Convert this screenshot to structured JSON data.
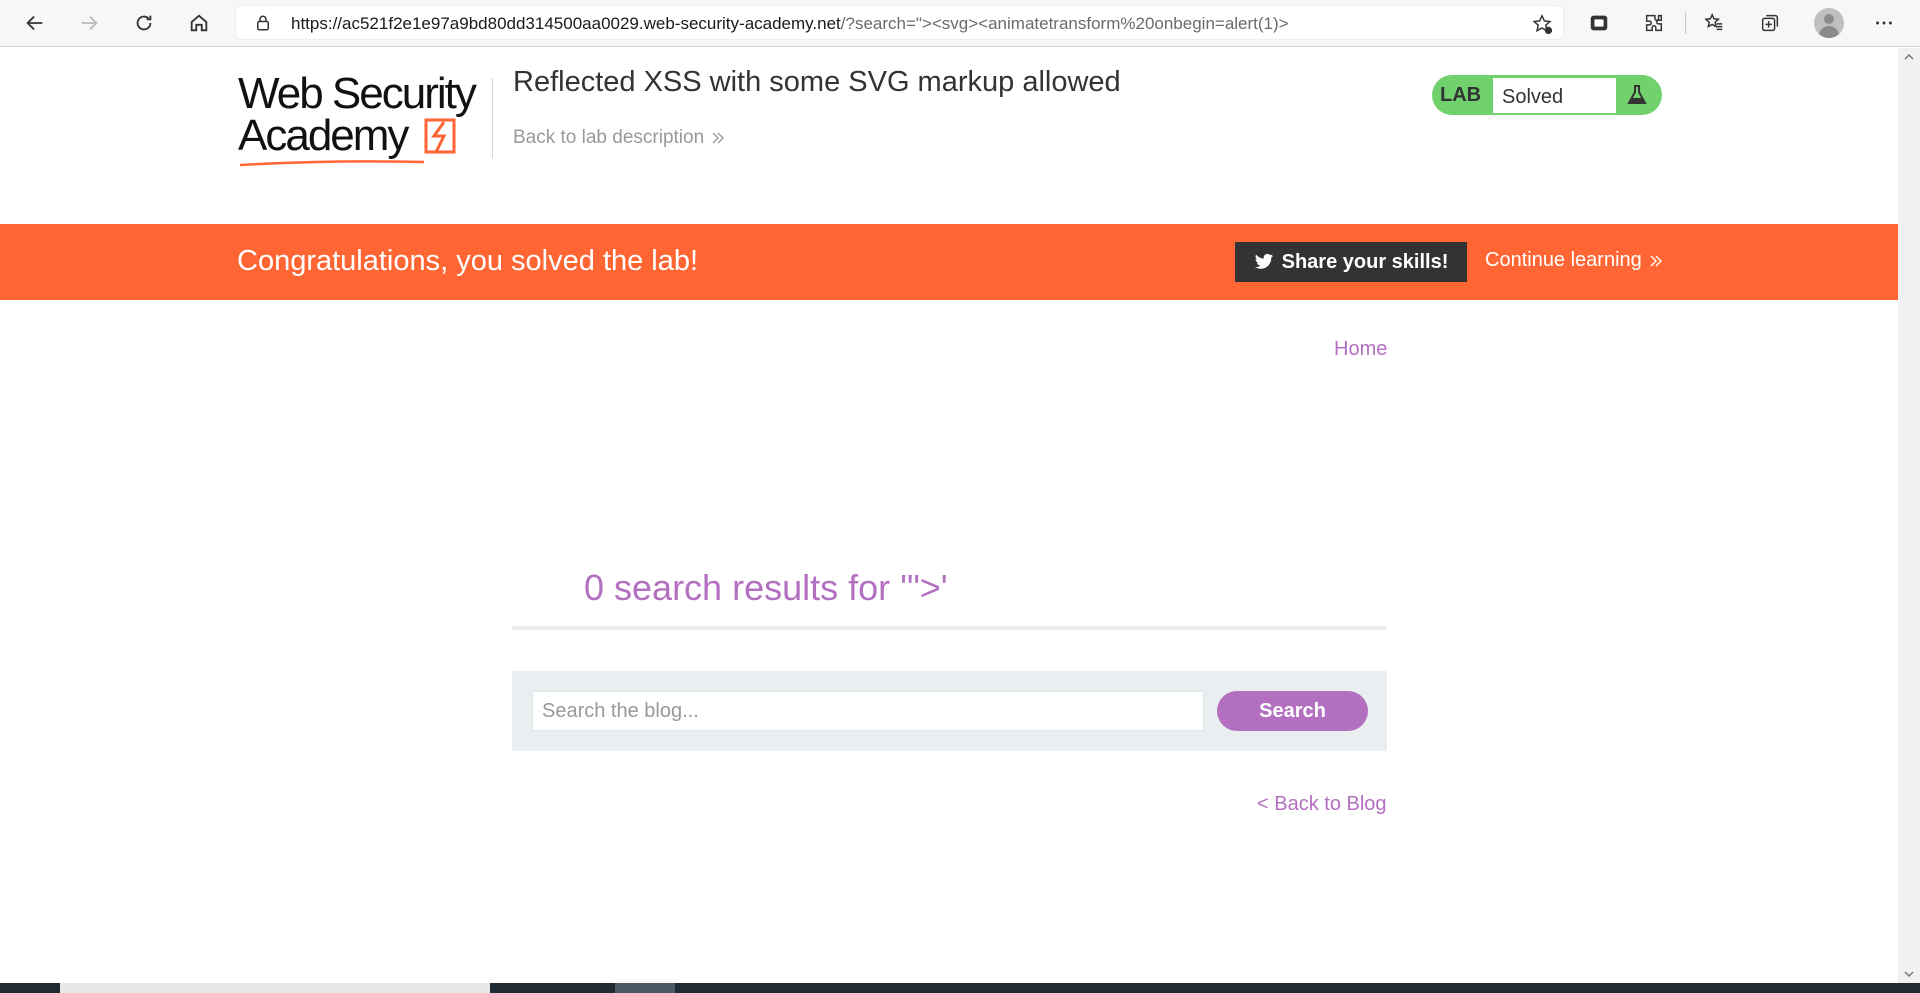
{
  "browser": {
    "url_host": "https://ac521f2e1e97a9bd80dd314500aa0029.web-security-academy.net",
    "url_rest": "/?search=\"><svg><animatetransform%20onbegin=alert(1)>"
  },
  "header": {
    "logo_line1": "Web Security",
    "logo_line2": "Academy",
    "title": "Reflected XSS with some SVG markup allowed",
    "back_link": "Back to lab description",
    "status_lab": "LAB",
    "status_value": "Solved"
  },
  "banner": {
    "message": "Congratulations, you solved the lab!",
    "share_label": "Share your skills!",
    "continue_label": "Continue learning"
  },
  "nav": {
    "home_label": "Home"
  },
  "main": {
    "results_heading": "0 search results for '\">'",
    "search_placeholder": "Search the blog...",
    "search_button": "Search",
    "back_to_blog": "< Back to Blog"
  },
  "colors": {
    "accent_orange": "#ff6633",
    "accent_purple": "#b36fc0",
    "status_green": "#70d16d"
  }
}
